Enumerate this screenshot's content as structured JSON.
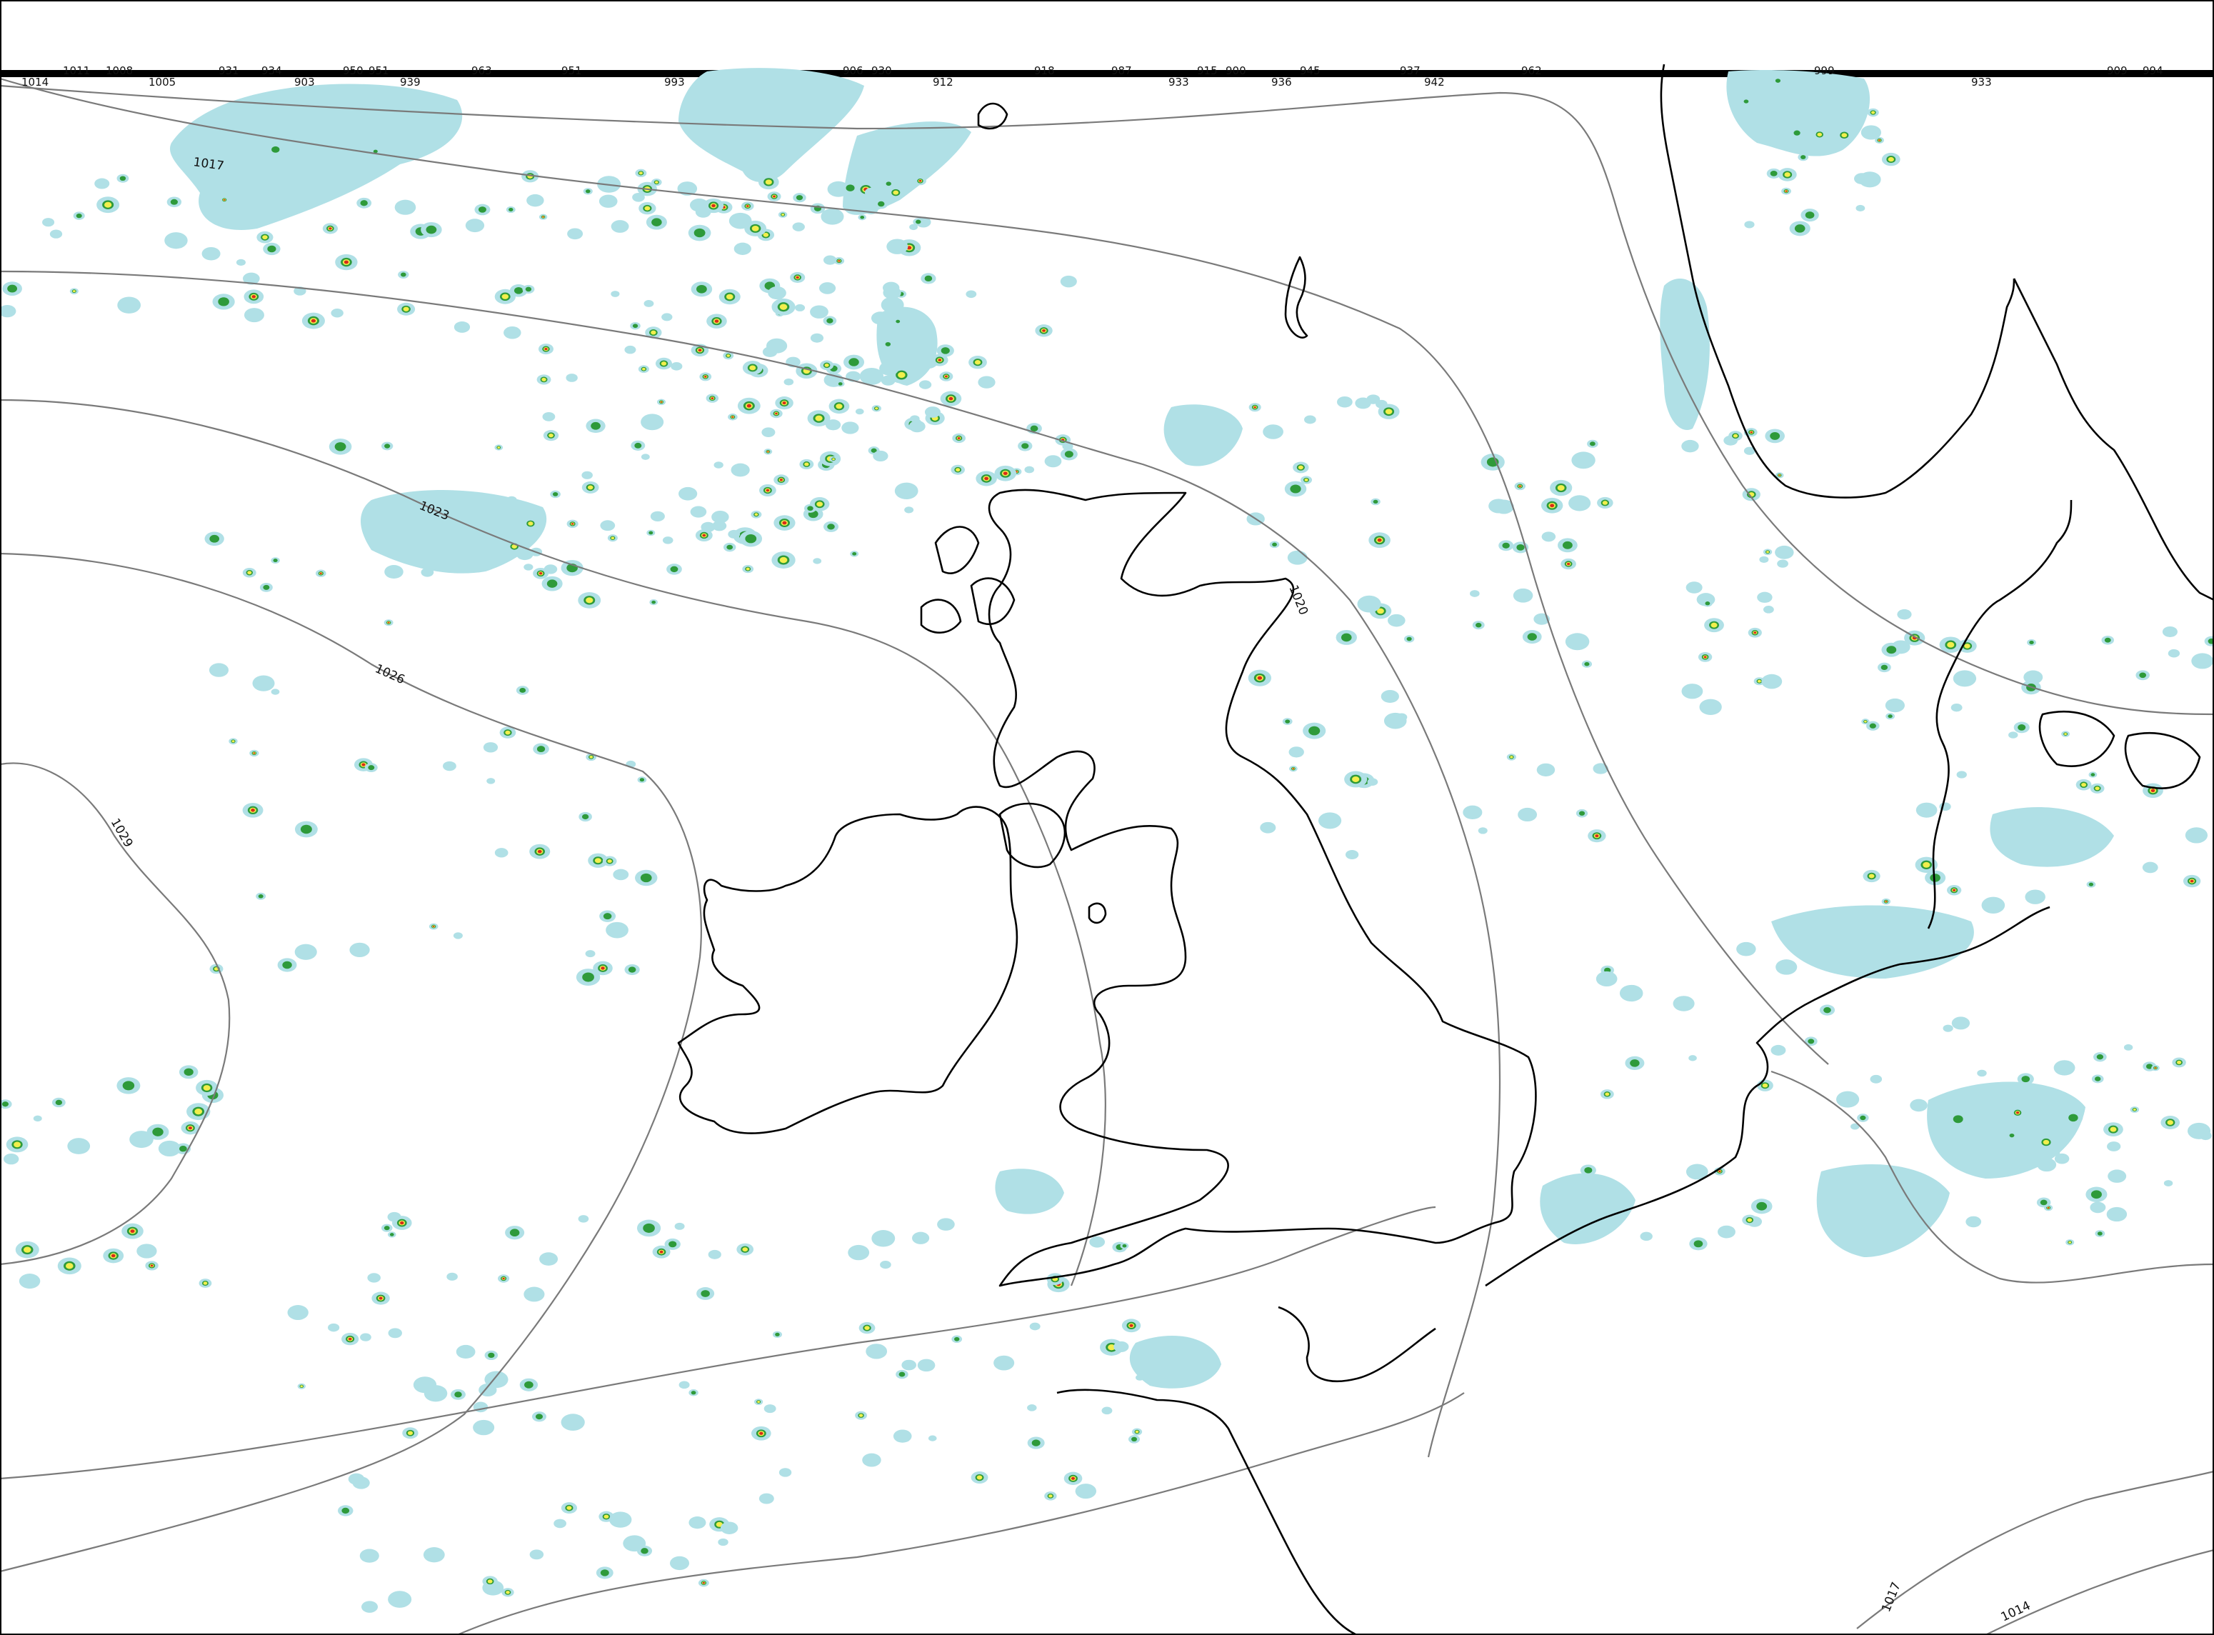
{
  "map": {
    "type": "synoptic pressure and precipitation chart",
    "region": "British Isles and NW Europe",
    "isobar_labels": [
      {
        "id": "iso-1017-n",
        "text": "1017"
      },
      {
        "id": "iso-1020",
        "text": "1020"
      },
      {
        "id": "iso-1023",
        "text": "1023"
      },
      {
        "id": "iso-1026",
        "text": "1026"
      },
      {
        "id": "iso-1029",
        "text": "1029"
      },
      {
        "id": "iso-1017-se",
        "text": "1017"
      },
      {
        "id": "iso-1014-se",
        "text": "1014"
      }
    ],
    "top_strip_labels": [
      "1014",
      "1011",
      "1008",
      "1005",
      "931",
      "934",
      "903",
      "950",
      "951",
      "939",
      "963",
      "951",
      "993",
      "906",
      "930",
      "912",
      "918",
      "987",
      "933",
      "915",
      "900",
      "936",
      "945",
      "937",
      "942",
      "962",
      "999",
      "933",
      "909",
      "994"
    ],
    "colors": {
      "light_rain": "#b0e0e6",
      "moderate_rain": "#2e9a3a",
      "heavy_rain": "#f2ef4c",
      "very_heavy_rain": "#d82a1a",
      "isobar": "#7a7a7a",
      "coastline": "#000000"
    }
  }
}
